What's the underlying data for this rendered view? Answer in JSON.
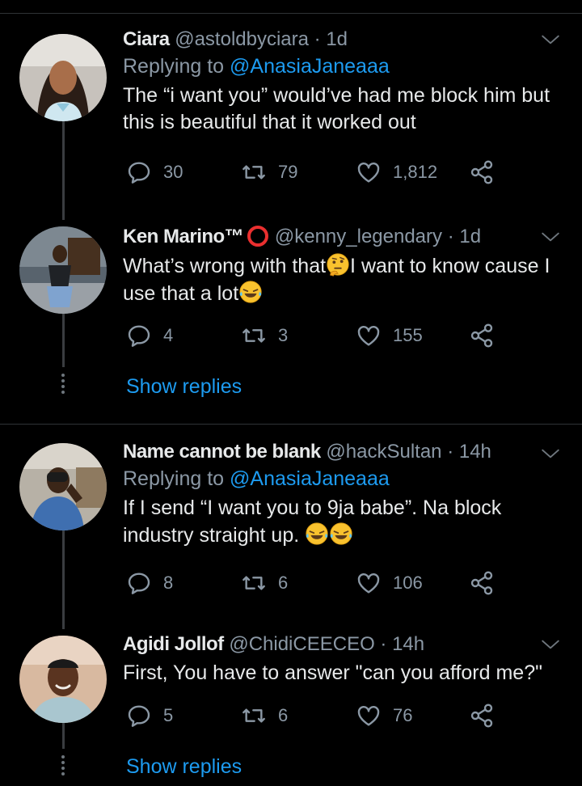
{
  "tweets": [
    {
      "name": "Ciara",
      "handle": "@astoldbyciara",
      "time": "· 1d",
      "replying_prefix": "Replying to ",
      "replying_to": "@AnasiaJaneaaa",
      "text": "The “i want you” would’ve had me block him but this is beautiful that it worked out",
      "replies": "30",
      "retweets": "79",
      "likes": "1,812"
    },
    {
      "name": "Ken Marino™",
      "handle": "@kenny_legendary",
      "time": "· 1d",
      "text_part1": "What’s wrong with that",
      "text_part2": "I want to know cause I use that a lot",
      "replies": "4",
      "retweets": "3",
      "likes": "155",
      "show_replies": "Show replies"
    },
    {
      "name": "Name cannot be blank",
      "handle": "@hackSultan",
      "time": "· 14h",
      "replying_prefix": "Replying to ",
      "replying_to": "@AnasiaJaneaaa",
      "text": "If I send “I want you to 9ja babe”. Na block industry straight up. ",
      "replies": "8",
      "retweets": "6",
      "likes": "106"
    },
    {
      "name": "Agidi Jollof",
      "handle": "@ChidiCEECEO",
      "time": "· 14h",
      "text": "First, You have to answer \"can you afford me?\"",
      "replies": "5",
      "retweets": "6",
      "likes": "76",
      "show_replies": "Show replies"
    }
  ],
  "colors": {
    "background": "#000000",
    "text": "#e7e9ea",
    "muted": "#8b98a5",
    "accent": "#1d9bf0",
    "divider": "#2f3336"
  },
  "icons": [
    "reply-icon",
    "retweet-icon",
    "like-icon",
    "share-icon",
    "chevron-down-icon",
    "circle-emoji",
    "thinking-emoji",
    "laughing-emoji"
  ]
}
